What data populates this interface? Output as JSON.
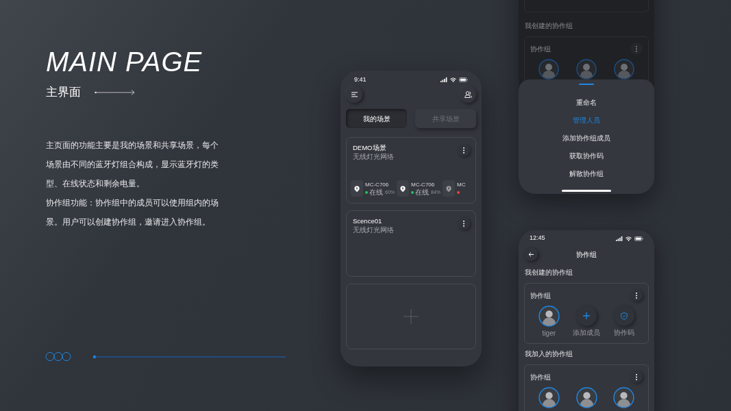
{
  "heading": {
    "title": "MAIN PAGE",
    "subtitle": "主界面"
  },
  "description": [
    "主页面的功能主要是我的场景和共享场景，每个场景由不同的蓝牙灯组合构成，显示蓝牙灯的类型、在线状态和剩余电量。",
    "协作组功能：协作组中的成员可以使用组内的场景。用户可以创建协作组，邀请进入协作组。"
  ],
  "home_screen": {
    "status_bar": {
      "time": "9:41"
    },
    "tabs": [
      {
        "label": "我的场景",
        "selected": true
      },
      {
        "label": "共享场景",
        "selected": false
      }
    ],
    "scenes": [
      {
        "title": "DEMO场景",
        "subtitle": "无线灯光网络",
        "devices": [
          {
            "name": "MC-C706",
            "status": "在线",
            "battery": "60%",
            "color": "#22c55e"
          },
          {
            "name": "MC-C706",
            "status": "在线",
            "battery": "84%",
            "color": "#22c55e"
          },
          {
            "name": "MC",
            "color": "#ef4444"
          }
        ]
      },
      {
        "title": "Scence01",
        "subtitle": "无线灯光网络"
      }
    ]
  },
  "sheet_screen": {
    "section_title": "我创建的协作组",
    "group": {
      "title": "协作组",
      "members": [
        {
          "kind": "avatar"
        },
        {
          "kind": "avatar"
        },
        {
          "kind": "avatar"
        }
      ]
    },
    "menu": [
      {
        "label": "重命名",
        "selected": false
      },
      {
        "label": "管理人员",
        "selected": true
      },
      {
        "label": "添加协作组成员",
        "selected": false
      },
      {
        "label": "获取协作码",
        "selected": false
      },
      {
        "label": "解散协作组",
        "selected": false
      }
    ]
  },
  "group_screen": {
    "status_bar": {
      "time": "12:45"
    },
    "title": "协作组",
    "sections": [
      {
        "title": "我创建的协作组",
        "groups": [
          {
            "title": "协作组",
            "members": [
              {
                "kind": "avatar",
                "label": "tiger"
              },
              {
                "kind": "add",
                "label": "添加成员"
              },
              {
                "kind": "code",
                "label": "协作码"
              }
            ]
          }
        ]
      },
      {
        "title": "我加入的协作组",
        "groups": [
          {
            "title": "协作组",
            "members": [
              {
                "kind": "avatar"
              },
              {
                "kind": "avatar"
              },
              {
                "kind": "avatar"
              }
            ]
          }
        ]
      }
    ]
  }
}
